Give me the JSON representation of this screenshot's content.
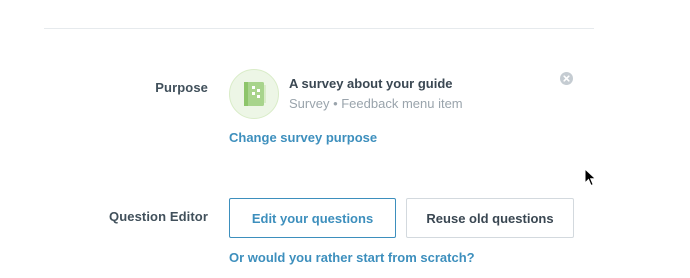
{
  "purpose": {
    "label": "Purpose",
    "icon": "survey-book-icon",
    "title": "A survey about your guide",
    "subtitle": "Survey • Feedback menu item",
    "change_link": "Change survey purpose",
    "remove_icon": "close-icon"
  },
  "question_editor": {
    "label": "Question Editor",
    "edit_button": "Edit your questions",
    "reuse_button": "Reuse old questions",
    "scratch_link": "Or would you rather start from scratch?"
  },
  "colors": {
    "accent": "#3d8fbd",
    "icon_bg": "#edf6e6",
    "icon_fg": "#8dc56a",
    "text": "#3a4752",
    "muted": "#9aa4ac"
  }
}
